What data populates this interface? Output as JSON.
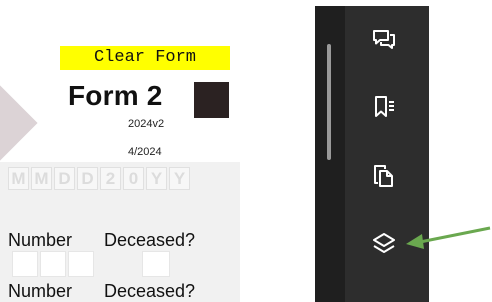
{
  "form": {
    "clear_button": "Clear Form",
    "title": "Form 2",
    "version": "2024v2",
    "date": "4/2024",
    "date_mask": [
      "M",
      "M",
      "D",
      "D",
      "2",
      "0",
      "Y",
      "Y"
    ],
    "labels": {
      "number": "Number",
      "deceased": "Deceased?"
    }
  },
  "side_toolbar": {
    "tools": [
      "comment-icon",
      "bookmark-icon",
      "copy-pages-icon",
      "layers-icon"
    ],
    "highlighted_tool": "layers-icon"
  },
  "colors": {
    "clear_button_bg": "#ffff00",
    "panel_bg": "#2d2d2d",
    "arrow": "#6aa84f"
  }
}
